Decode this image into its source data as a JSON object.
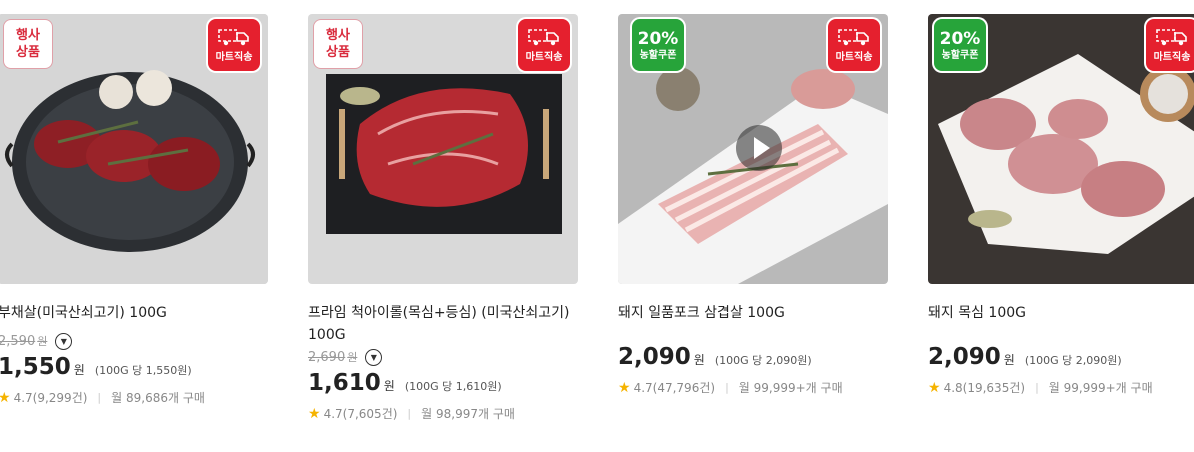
{
  "products": [
    {
      "name": "부채살(미국산쇠고기) 100G",
      "badge": {
        "type": "event",
        "line1": "행사",
        "line2": "상품"
      },
      "delivery_label": "마트직송",
      "original_price": "2,590",
      "won": "원",
      "price": "1,550",
      "unit_price": "(100G 당 1,550원)",
      "rating": "4.7",
      "review_count": "(9,299건)",
      "monthly": "월 89,686개 구매"
    },
    {
      "name": "프라임 척아이롤(목심+등심) (미국산쇠고기) 100G",
      "badge": {
        "type": "event",
        "line1": "행사",
        "line2": "상품"
      },
      "delivery_label": "마트직송",
      "original_price": "2,690",
      "won": "원",
      "price": "1,610",
      "unit_price": "(100G 당 1,610원)",
      "rating": "4.7",
      "review_count": "(7,605건)",
      "monthly": "월 98,997개 구매"
    },
    {
      "name": "돼지 일품포크 삼겹살 100G",
      "badge": {
        "type": "coupon",
        "line1": "20%",
        "line2": "농할쿠폰"
      },
      "delivery_label": "마트직송",
      "original_price": "",
      "won": "원",
      "price": "2,090",
      "unit_price": "(100G 당 2,090원)",
      "rating": "4.7",
      "review_count": "(47,796건)",
      "monthly": "월 99,999+개 구매"
    },
    {
      "name": "돼지 목심 100G",
      "badge": {
        "type": "coupon",
        "line1": "20%",
        "line2": "농할쿠폰"
      },
      "delivery_label": "마트직송",
      "original_price": "",
      "won": "원",
      "price": "2,090",
      "unit_price": "(100G 당 2,090원)",
      "rating": "4.8",
      "review_count": "(19,635건)",
      "monthly": "월 99,999+개 구매"
    }
  ],
  "colors": {
    "event_red": "#d92a3c",
    "delivery_red": "#e5202e",
    "coupon_green": "#27a43a",
    "star": "#f5b300"
  },
  "icons": {
    "delivery": "truck-icon",
    "rating": "star-icon",
    "expand": "chevron-down-icon",
    "video": "play-icon"
  }
}
